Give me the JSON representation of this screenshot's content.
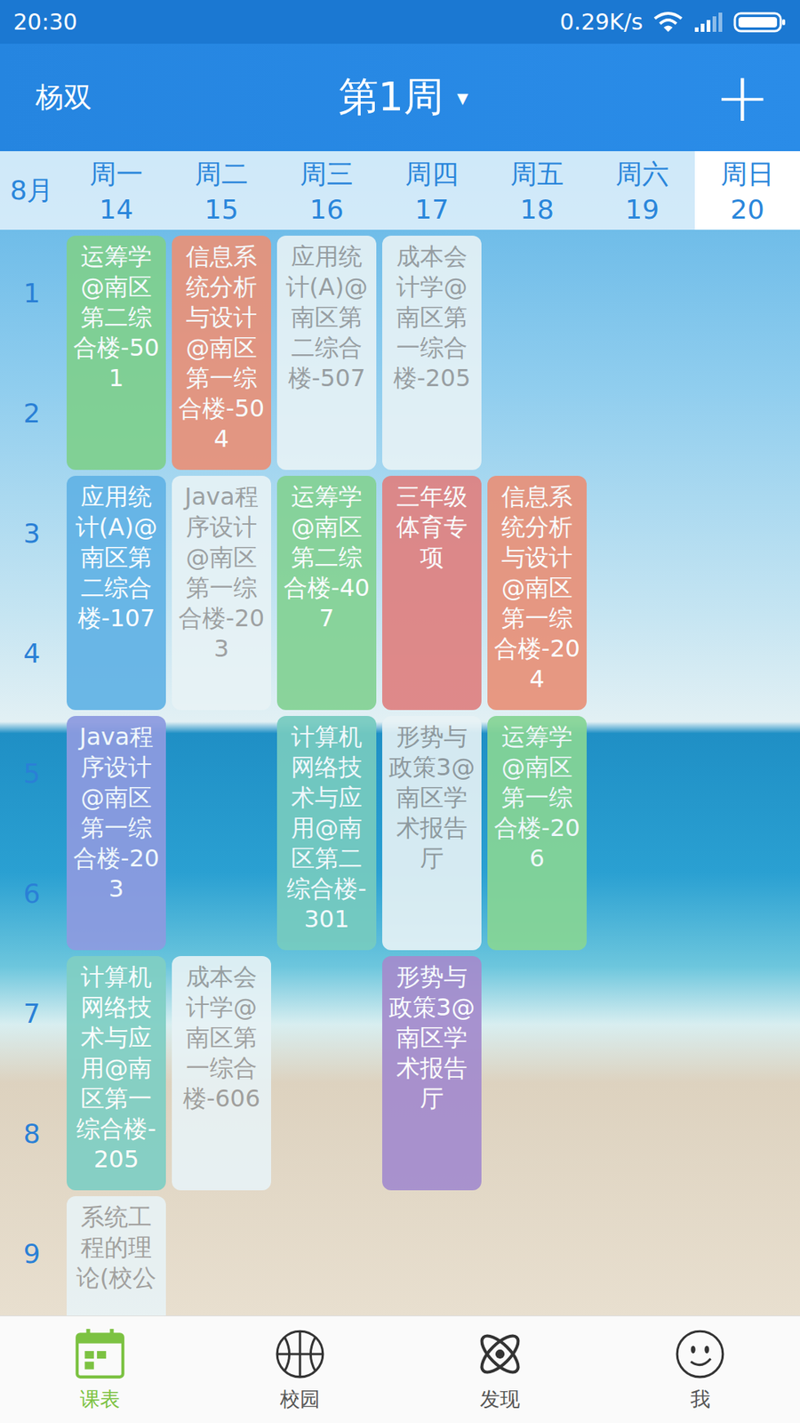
{
  "status_bar": {
    "time": "20:30",
    "speed": "0.29K/s"
  },
  "header": {
    "user": "杨双",
    "week": "第1周",
    "dropdown": "▾",
    "add": "+"
  },
  "month": "8月",
  "days": [
    {
      "name": "周一",
      "date": "14",
      "selected": false
    },
    {
      "name": "周二",
      "date": "15",
      "selected": false
    },
    {
      "name": "周三",
      "date": "16",
      "selected": false
    },
    {
      "name": "周四",
      "date": "17",
      "selected": false
    },
    {
      "name": "周五",
      "date": "18",
      "selected": false
    },
    {
      "name": "周六",
      "date": "19",
      "selected": false
    },
    {
      "name": "周日",
      "date": "20",
      "selected": true
    }
  ],
  "periods": [
    "1",
    "2",
    "3",
    "4",
    "5",
    "6",
    "7",
    "8",
    "9"
  ],
  "courses": [
    {
      "text": "运筹学@南区第二综合楼-501",
      "day": 1,
      "start": 1,
      "span": 2,
      "this_week": true,
      "color": "#7fd08f"
    },
    {
      "text": "信息系统分析与设计@南区第一综合楼-504",
      "day": 2,
      "start": 1,
      "span": 2,
      "this_week": true,
      "color": "#e8927a"
    },
    {
      "text": "应用统计(A)@南区第二综合楼-507",
      "day": 3,
      "start": 1,
      "span": 2,
      "this_week": false,
      "color": "#e8f3f6"
    },
    {
      "text": "成本会计学@南区第一综合楼-205",
      "day": 4,
      "start": 1,
      "span": 2,
      "this_week": false,
      "color": "#e8f3f6"
    },
    {
      "text": "应用统计(A)@南区第二综合楼-107",
      "day": 1,
      "start": 3,
      "span": 2,
      "this_week": true,
      "color": "#62b3e6"
    },
    {
      "text": "Java程序设计@南区第一综合楼-203",
      "day": 2,
      "start": 3,
      "span": 2,
      "this_week": false,
      "color": "#e8f3f6"
    },
    {
      "text": "运筹学@南区第二综合楼-407",
      "day": 3,
      "start": 3,
      "span": 2,
      "this_week": true,
      "color": "#84d295"
    },
    {
      "text": "三年级体育专项",
      "day": 4,
      "start": 3,
      "span": 2,
      "this_week": true,
      "color": "#df8282"
    },
    {
      "text": "信息系统分析与设计@南区第一综合楼-204",
      "day": 5,
      "start": 3,
      "span": 2,
      "this_week": true,
      "color": "#e8927a"
    },
    {
      "text": "Java程序设计@南区第一综合楼-203",
      "day": 1,
      "start": 5,
      "span": 2,
      "this_week": true,
      "color": "#8d9be0"
    },
    {
      "text": "计算机网络技术与应用@南区第二综合楼-301",
      "day": 3,
      "start": 5,
      "span": 2,
      "this_week": true,
      "color": "#76cbc0"
    },
    {
      "text": "形势与政策3@南区学术报告厅",
      "day": 4,
      "start": 5,
      "span": 2,
      "this_week": false,
      "color": "#e8f3f6"
    },
    {
      "text": "运筹学@南区第一综合楼-206",
      "day": 5,
      "start": 5,
      "span": 2,
      "this_week": true,
      "color": "#86d596"
    },
    {
      "text": "计算机网络技术与应用@南区第一综合楼-205",
      "day": 1,
      "start": 7,
      "span": 2,
      "this_week": true,
      "color": "#80cfc4"
    },
    {
      "text": "成本会计学@南区第一综合楼-606",
      "day": 2,
      "start": 7,
      "span": 2,
      "this_week": false,
      "color": "#e8f3f6"
    },
    {
      "text": "形势与政策3@南区学术报告厅",
      "day": 4,
      "start": 7,
      "span": 2,
      "this_week": true,
      "color": "#a48ccd"
    },
    {
      "text": "系统工程的理论(校公",
      "day": 1,
      "start": 9,
      "span": 2,
      "this_week": false,
      "color": "#e8f3f6"
    }
  ],
  "nav": [
    {
      "label": "课表",
      "selected": true
    },
    {
      "label": "校园",
      "selected": false
    },
    {
      "label": "发现",
      "selected": false
    },
    {
      "label": "我",
      "selected": false
    }
  ]
}
